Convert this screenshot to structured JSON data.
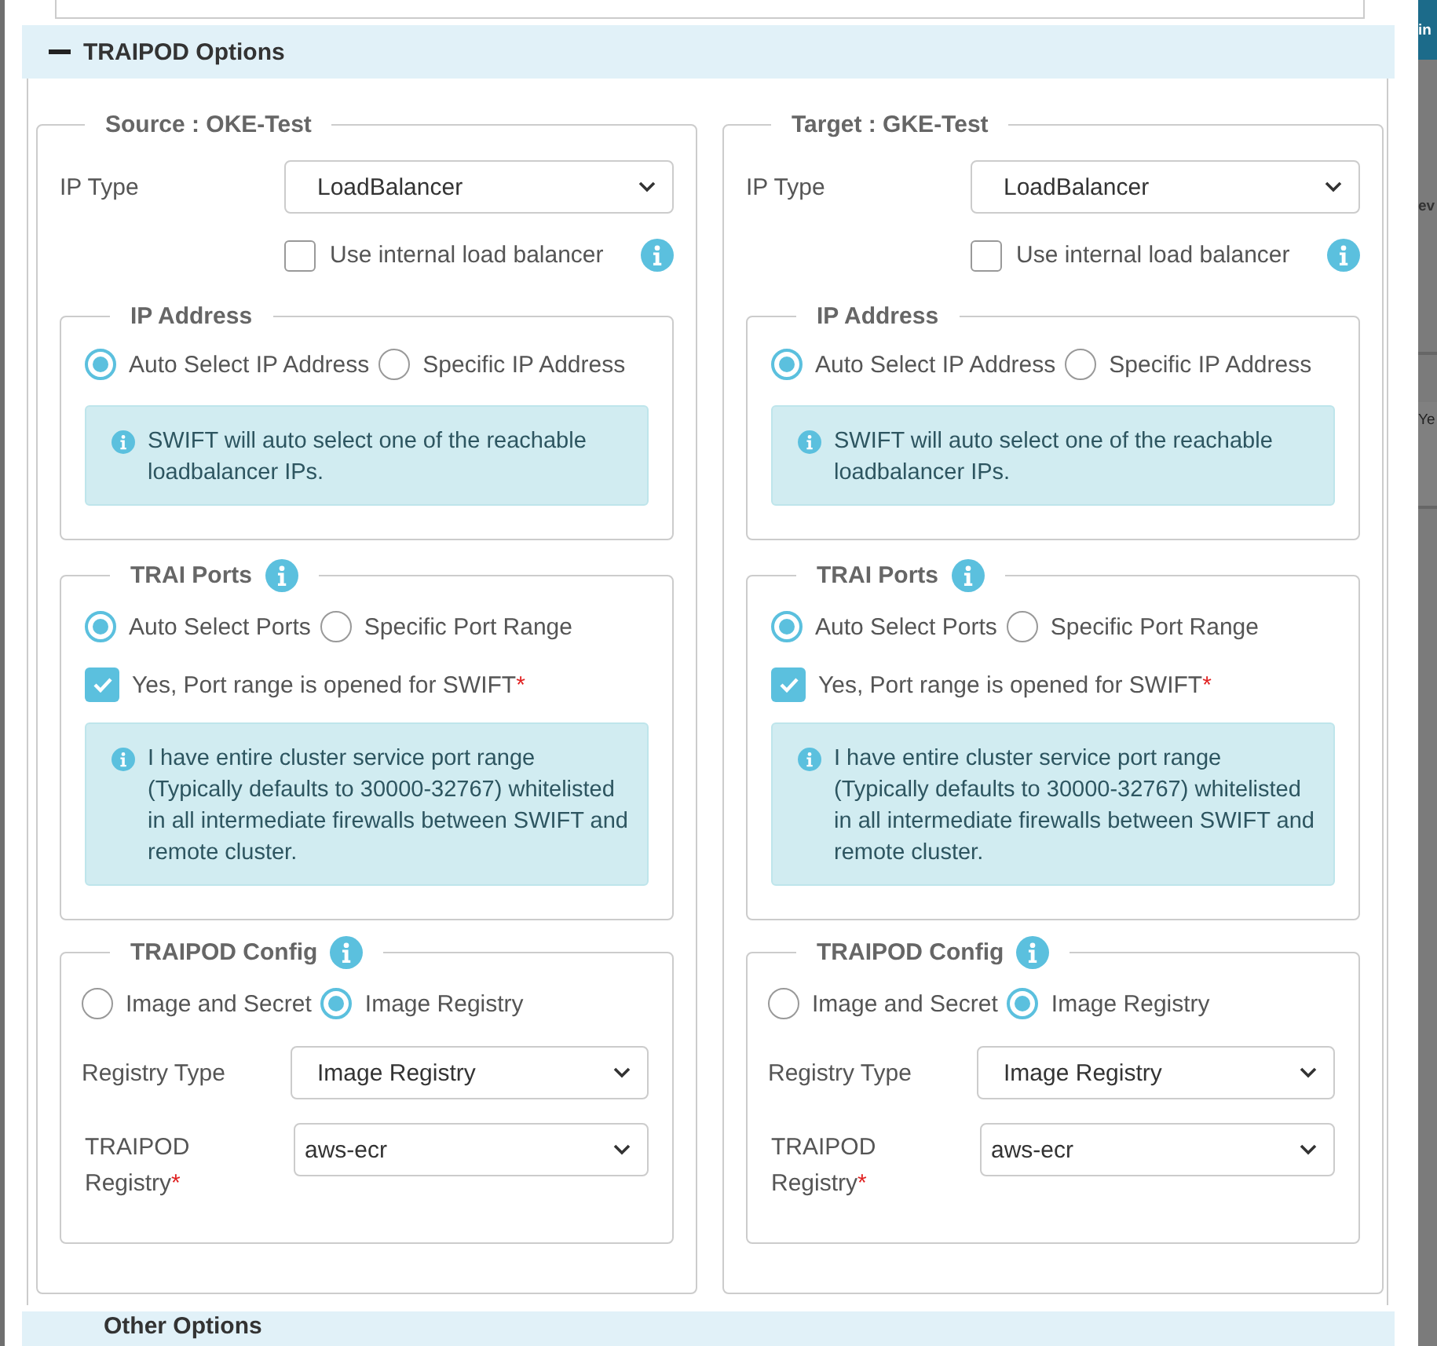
{
  "backdrop": {
    "fragments": [
      "in",
      "ev",
      "Ye"
    ]
  },
  "traipod_panel": {
    "title": "TRAIPOD Options",
    "expanded": true,
    "columns": [
      {
        "legend": "Source : OKE-Test",
        "ip_type": {
          "label": "IP Type",
          "value": "LoadBalancer"
        },
        "internal_lb": {
          "label": "Use internal load balancer",
          "checked": false
        },
        "ip_address": {
          "legend": "IP Address",
          "options": [
            {
              "label": "Auto Select IP Address",
              "selected": true
            },
            {
              "label": "Specific IP Address",
              "selected": false
            }
          ],
          "alert": "SWIFT will auto select one of the reachable loadbalancer IPs."
        },
        "ports": {
          "legend": "TRAI Ports",
          "options": [
            {
              "label": "Auto Select Ports",
              "selected": true
            },
            {
              "label": "Specific Port Range",
              "selected": false
            }
          ],
          "confirm": {
            "label": "Yes, Port range is opened for SWIFT",
            "mark": "*",
            "checked": true
          },
          "alert": "I have entire cluster service port range (Typically defaults to 30000-32767) whitelisted in all intermediate firewalls between SWIFT and remote cluster."
        },
        "config": {
          "legend": "TRAIPOD Config",
          "options": [
            {
              "label": "Image and Secret",
              "selected": false
            },
            {
              "label": "Image Registry",
              "selected": true
            }
          ],
          "registry_type": {
            "label": "Registry Type",
            "value": "Image Registry"
          },
          "registry": {
            "label": "TRAIPOD Registry",
            "mark": "*",
            "value": "aws-ecr"
          }
        }
      },
      {
        "legend": "Target : GKE-Test",
        "ip_type": {
          "label": "IP Type",
          "value": "LoadBalancer"
        },
        "internal_lb": {
          "label": "Use internal load balancer",
          "checked": false
        },
        "ip_address": {
          "legend": "IP Address",
          "options": [
            {
              "label": "Auto Select IP Address",
              "selected": true
            },
            {
              "label": "Specific IP Address",
              "selected": false
            }
          ],
          "alert": "SWIFT will auto select one of the reachable loadbalancer IPs."
        },
        "ports": {
          "legend": "TRAI Ports",
          "options": [
            {
              "label": "Auto Select Ports",
              "selected": true
            },
            {
              "label": "Specific Port Range",
              "selected": false
            }
          ],
          "confirm": {
            "label": "Yes, Port range is opened for SWIFT",
            "mark": "*",
            "checked": true
          },
          "alert": "I have entire cluster service port range (Typically defaults to 30000-32767) whitelisted in all intermediate firewalls between SWIFT and remote cluster."
        },
        "config": {
          "legend": "TRAIPOD Config",
          "options": [
            {
              "label": "Image and Secret",
              "selected": false
            },
            {
              "label": "Image Registry",
              "selected": true
            }
          ],
          "registry_type": {
            "label": "Registry Type",
            "value": "Image Registry"
          },
          "registry": {
            "label": "TRAIPOD Registry",
            "mark": "*",
            "value": "aws-ecr"
          }
        }
      }
    ]
  },
  "next_panel": {
    "title": "Other Options"
  }
}
